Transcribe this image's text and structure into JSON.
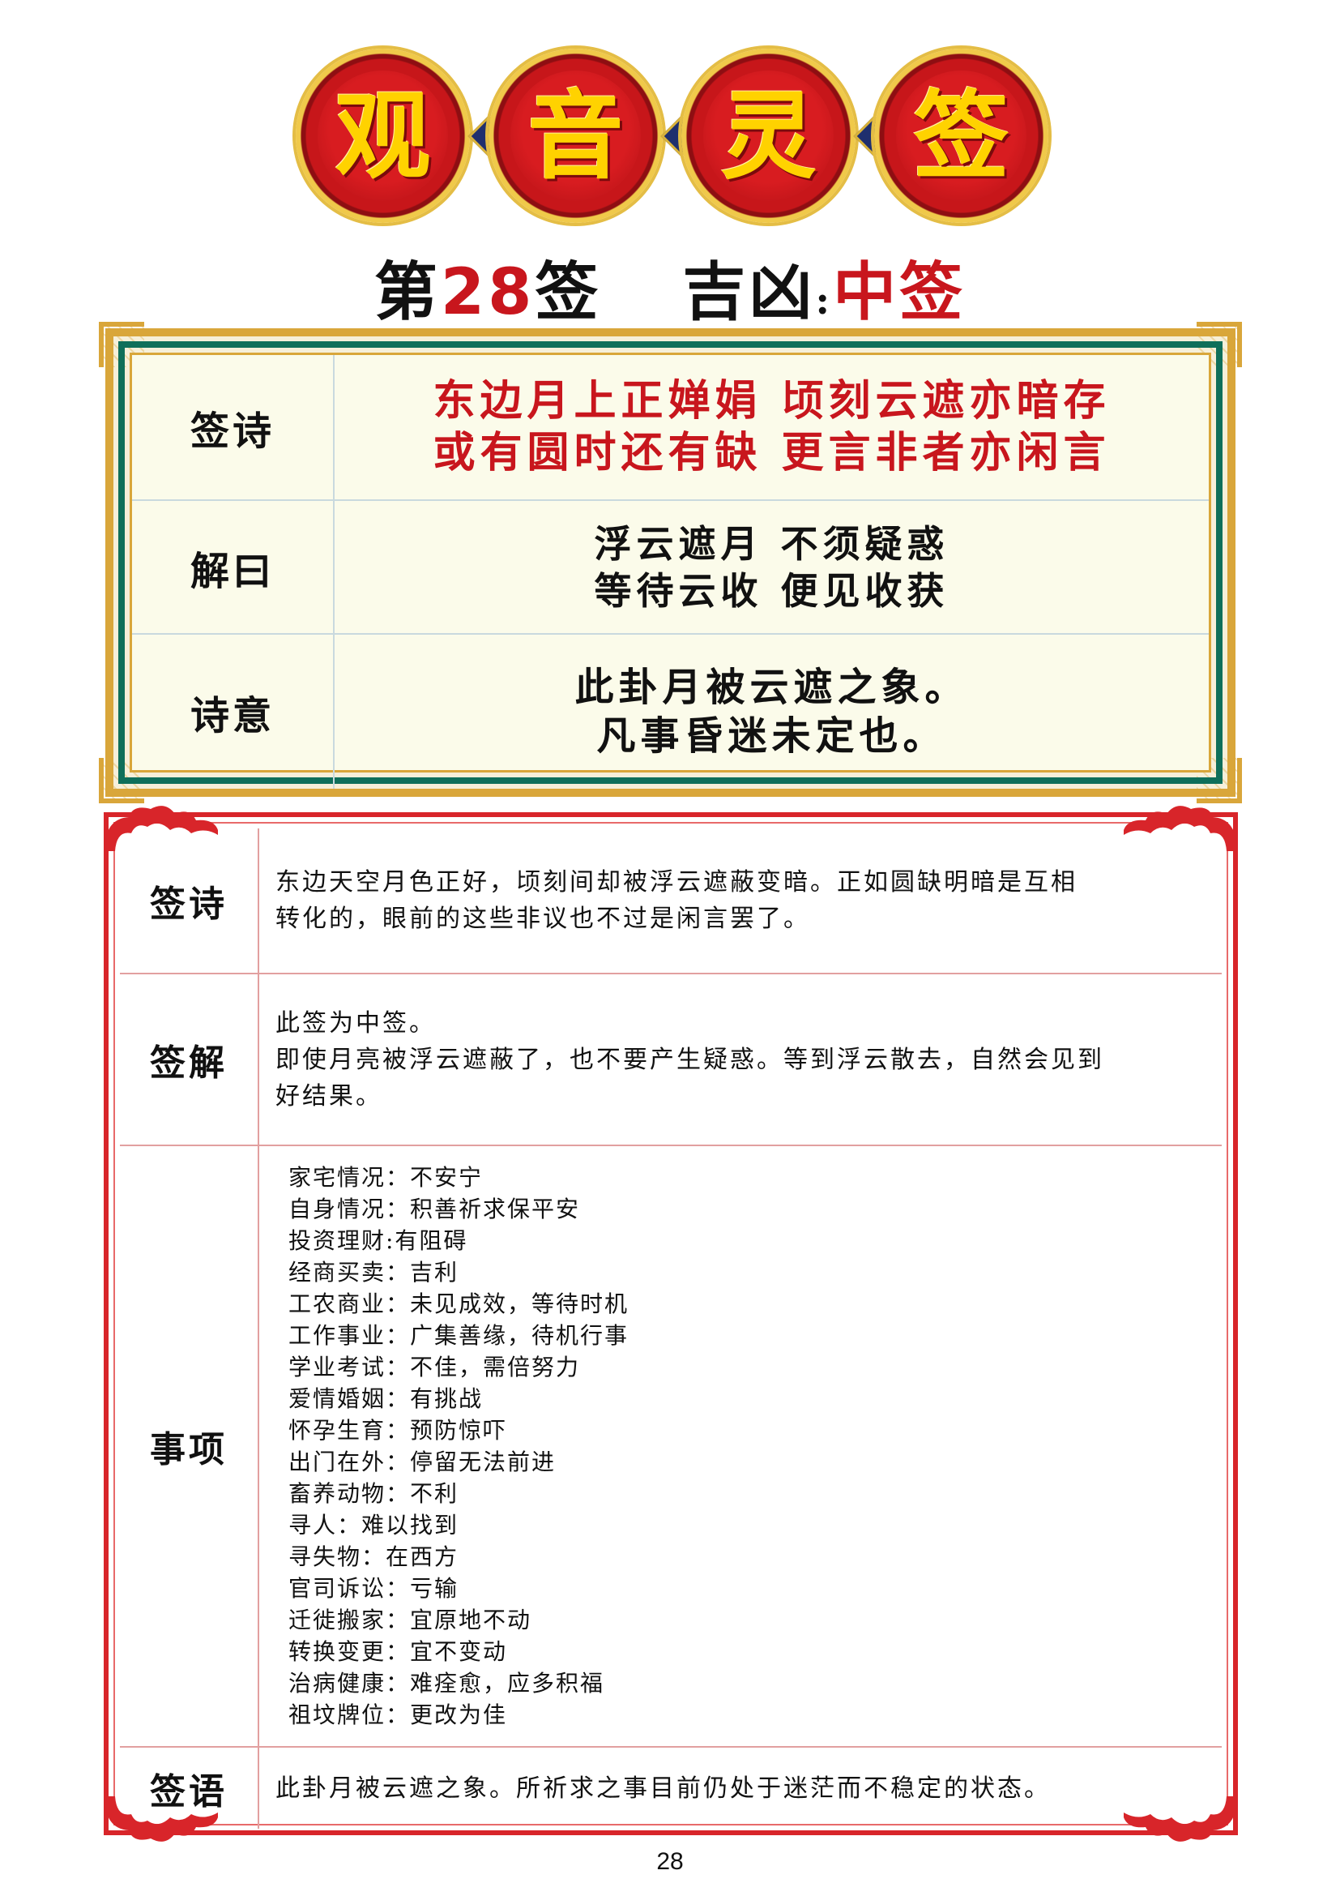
{
  "header": {
    "title_chars": [
      "观",
      "音",
      "灵",
      "签"
    ],
    "lot_prefix": "第",
    "lot_number": "28",
    "lot_suffix": "签",
    "fortune_label": "吉凶",
    "fortune_colon": ":",
    "fortune_value": "中签"
  },
  "upper_table": {
    "rows": [
      {
        "label": "签诗",
        "lines": [
          "东边月上正婵娟  顷刻云遮亦暗存",
          "或有圆时还有缺  更言非者亦闲言"
        ]
      },
      {
        "label": "解曰",
        "lines": [
          "浮云遮月  不须疑惑",
          "等待云收  便见收获"
        ]
      },
      {
        "label": "诗意",
        "lines": [
          "此卦月被云遮之象。",
          "凡事昏迷未定也。"
        ]
      }
    ]
  },
  "lower_table": {
    "poem": {
      "label": "签诗",
      "lines": [
        "东边天空月色正好，顷刻间却被浮云遮蔽变暗。正如圆缺明暗是互相",
        "转化的，眼前的这些非议也不过是闲言罢了。"
      ]
    },
    "explain": {
      "label": "签解",
      "lines": [
        "此签为中签。",
        "即使月亮被浮云遮蔽了，也不要产生疑惑。等到浮云散去，自然会见到",
        "好结果。"
      ]
    },
    "matters": {
      "label": "事项",
      "items": [
        "家宅情况：不安宁",
        "自身情况：积善祈求保平安",
        "投资理财:有阻碍",
        "经商买卖：吉利",
        "工农商业：未见成效，等待时机",
        "工作事业：广集善缘，待机行事",
        "学业考试：不佳，需倍努力",
        "爱情婚姻：有挑战",
        "怀孕生育：预防惊吓",
        "出门在外：停留无法前进",
        "畜养动物：不利",
        "寻人：难以找到",
        "寻失物：在西方",
        "官司诉讼：亏输",
        "迁徙搬家：宜原地不动",
        "转换变更：宜不变动",
        "治病健康：难痊愈，应多积福",
        "祖坟牌位：更改为佳"
      ]
    },
    "saying": {
      "label": "签语",
      "text": "此卦月被云遮之象。所祈求之事目前仍处于迷茫而不稳定的状态。"
    }
  },
  "footer": {
    "page_number": "28"
  },
  "colors": {
    "red": "#c8161d",
    "gold": "#d9a63a",
    "green": "#0f6f5a",
    "plaque_text": "#ffd200"
  }
}
